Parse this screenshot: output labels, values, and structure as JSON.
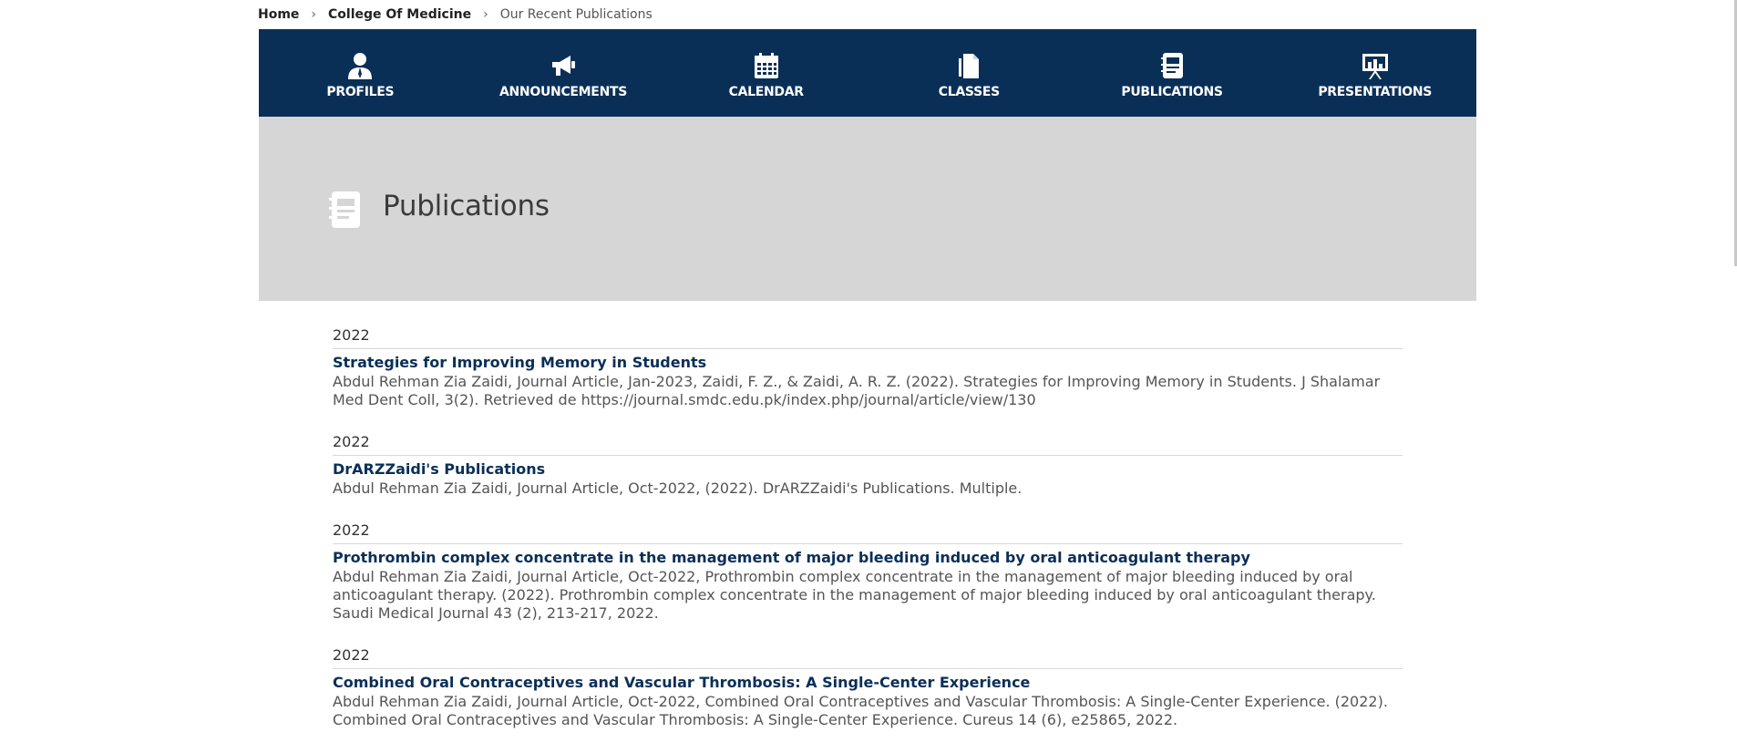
{
  "breadcrumb": {
    "items": [
      "Home",
      "College Of Medicine",
      "Our Recent Publications"
    ],
    "separator": "›"
  },
  "nav": {
    "items": [
      {
        "label": "PROFILES",
        "icon": "person-icon"
      },
      {
        "label": "ANNOUNCEMENTS",
        "icon": "megaphone-icon"
      },
      {
        "label": "CALENDAR",
        "icon": "calendar-icon"
      },
      {
        "label": "CLASSES",
        "icon": "documents-icon"
      },
      {
        "label": "PUBLICATIONS",
        "icon": "notebook-icon"
      },
      {
        "label": "PRESENTATIONS",
        "icon": "presentation-board-icon"
      }
    ]
  },
  "hero": {
    "title": "Publications",
    "icon": "notebook-icon"
  },
  "publications": [
    {
      "year": "2022",
      "title": "Strategies for Improving Memory in Students",
      "author": "Abdul Rehman Zia Zaidi",
      "citation": ", Journal Article, Jan-2023, Zaidi, F. Z., & Zaidi, A. R. Z. (2022). Strategies for Improving Memory in Students. J Shalamar Med Dent Coll, 3(2). Retrieved de https://journal.smdc.edu.pk/index.php/journal/article/view/130"
    },
    {
      "year": "2022",
      "title": "DrARZZaidi's Publications",
      "author": "Abdul Rehman Zia Zaidi",
      "citation": ", Journal Article, Oct-2022, (2022). DrARZZaidi's Publications. Multiple."
    },
    {
      "year": "2022",
      "title": "Prothrombin complex concentrate in the management of major bleeding induced by oral anticoagulant therapy",
      "author": "Abdul Rehman Zia Zaidi",
      "citation": ", Journal Article, Oct-2022, Prothrombin complex concentrate in the management of major bleeding induced by oral anticoagulant therapy. (2022). Prothrombin complex concentrate in the management of major bleeding induced by oral anticoagulant therapy. Saudi Medical Journal 43 (2), 213-217, 2022."
    },
    {
      "year": "2022",
      "title": "Combined Oral Contraceptives and Vascular Thrombosis: A Single-Center Experience",
      "author": "Abdul Rehman Zia Zaidi",
      "citation": ", Journal Article, Oct-2022, Combined Oral Contraceptives and Vascular Thrombosis: A Single-Center Experience. (2022). Combined Oral Contraceptives and Vascular Thrombosis: A Single-Center Experience. Cureus 14 (6), e25865, 2022."
    }
  ],
  "colors": {
    "nav_bg": "#0a2f57",
    "hero_bg": "#d6d6d6",
    "link": "#0a2f57"
  }
}
